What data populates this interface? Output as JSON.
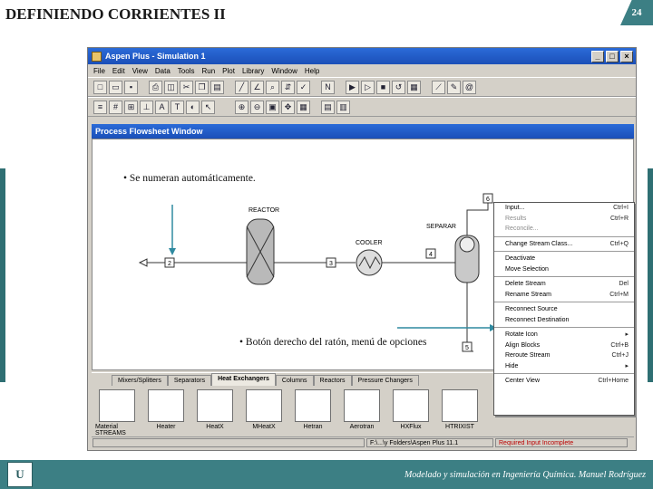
{
  "slide": {
    "title": "DEFINIENDO CORRIENTES II",
    "page_number": "24",
    "footer": "Modelado y simulación en Ingeniería Química. Manuel Rodríguez",
    "logo_text": "U"
  },
  "app": {
    "window_title": "Aspen Plus - Simulation 1",
    "menu": [
      "File",
      "Edit",
      "View",
      "Data",
      "Tools",
      "Run",
      "Plot",
      "Library",
      "Window",
      "Help"
    ],
    "flowsheet_title": "Process Flowsheet Window",
    "blocks": {
      "reactor_label": "REACTOR",
      "separ_label": "SEPARAR",
      "cooler_label": "COOLER"
    },
    "streams": [
      "2",
      "3",
      "4",
      "5",
      "6"
    ],
    "palette": {
      "tabs": [
        "Mixers/Splitters",
        "Separators",
        "Heat Exchangers",
        "Columns",
        "Reactors",
        "Pressure Changers"
      ],
      "active_tab": "Heat Exchangers",
      "models": [
        "Material STREAMS",
        "Heater",
        "HeatX",
        "MHeatX",
        "Hetran",
        "Aerotran",
        "HXFlux",
        "HTRIXIST"
      ]
    },
    "status": {
      "path": "F:\\...\\y Folders\\Aspen Plus 11.1",
      "state": "Required Input Incomplete"
    },
    "context_menu": [
      {
        "label": "Input...",
        "shortcut": "Ctrl+I",
        "enabled": true
      },
      {
        "label": "Results",
        "shortcut": "Ctrl+R",
        "enabled": false
      },
      {
        "label": "Reconcile...",
        "shortcut": "",
        "enabled": false
      },
      {
        "label": "Change Stream Class...",
        "shortcut": "Ctrl+Q",
        "enabled": true,
        "sep_before": true
      },
      {
        "label": "Deactivate",
        "shortcut": "",
        "enabled": true,
        "sep_before": true
      },
      {
        "label": "Move Selection",
        "shortcut": "",
        "enabled": true
      },
      {
        "label": "Delete Stream",
        "shortcut": "Del",
        "enabled": true,
        "sep_before": true
      },
      {
        "label": "Rename Stream",
        "shortcut": "Ctrl+M",
        "enabled": true
      },
      {
        "label": "Reconnect Source",
        "shortcut": "",
        "enabled": true,
        "sep_before": true
      },
      {
        "label": "Reconnect Destination",
        "shortcut": "",
        "enabled": true
      },
      {
        "label": "Rotate Icon",
        "shortcut": "▸",
        "enabled": true,
        "sep_before": true
      },
      {
        "label": "Align Blocks",
        "shortcut": "Ctrl+B",
        "enabled": true
      },
      {
        "label": "Reroute Stream",
        "shortcut": "Ctrl+J",
        "enabled": true
      },
      {
        "label": "Hide",
        "shortcut": "▸",
        "enabled": true
      },
      {
        "label": "Center View",
        "shortcut": "Ctrl+Home",
        "enabled": true,
        "sep_before": true
      }
    ]
  },
  "notes": {
    "top": "• Se numeran automáticamente.",
    "bottom": "• Botón derecho del ratón, menú de opciones"
  },
  "colors": {
    "accent": "#3c7f84",
    "titlebar": "#1b4fb8"
  }
}
